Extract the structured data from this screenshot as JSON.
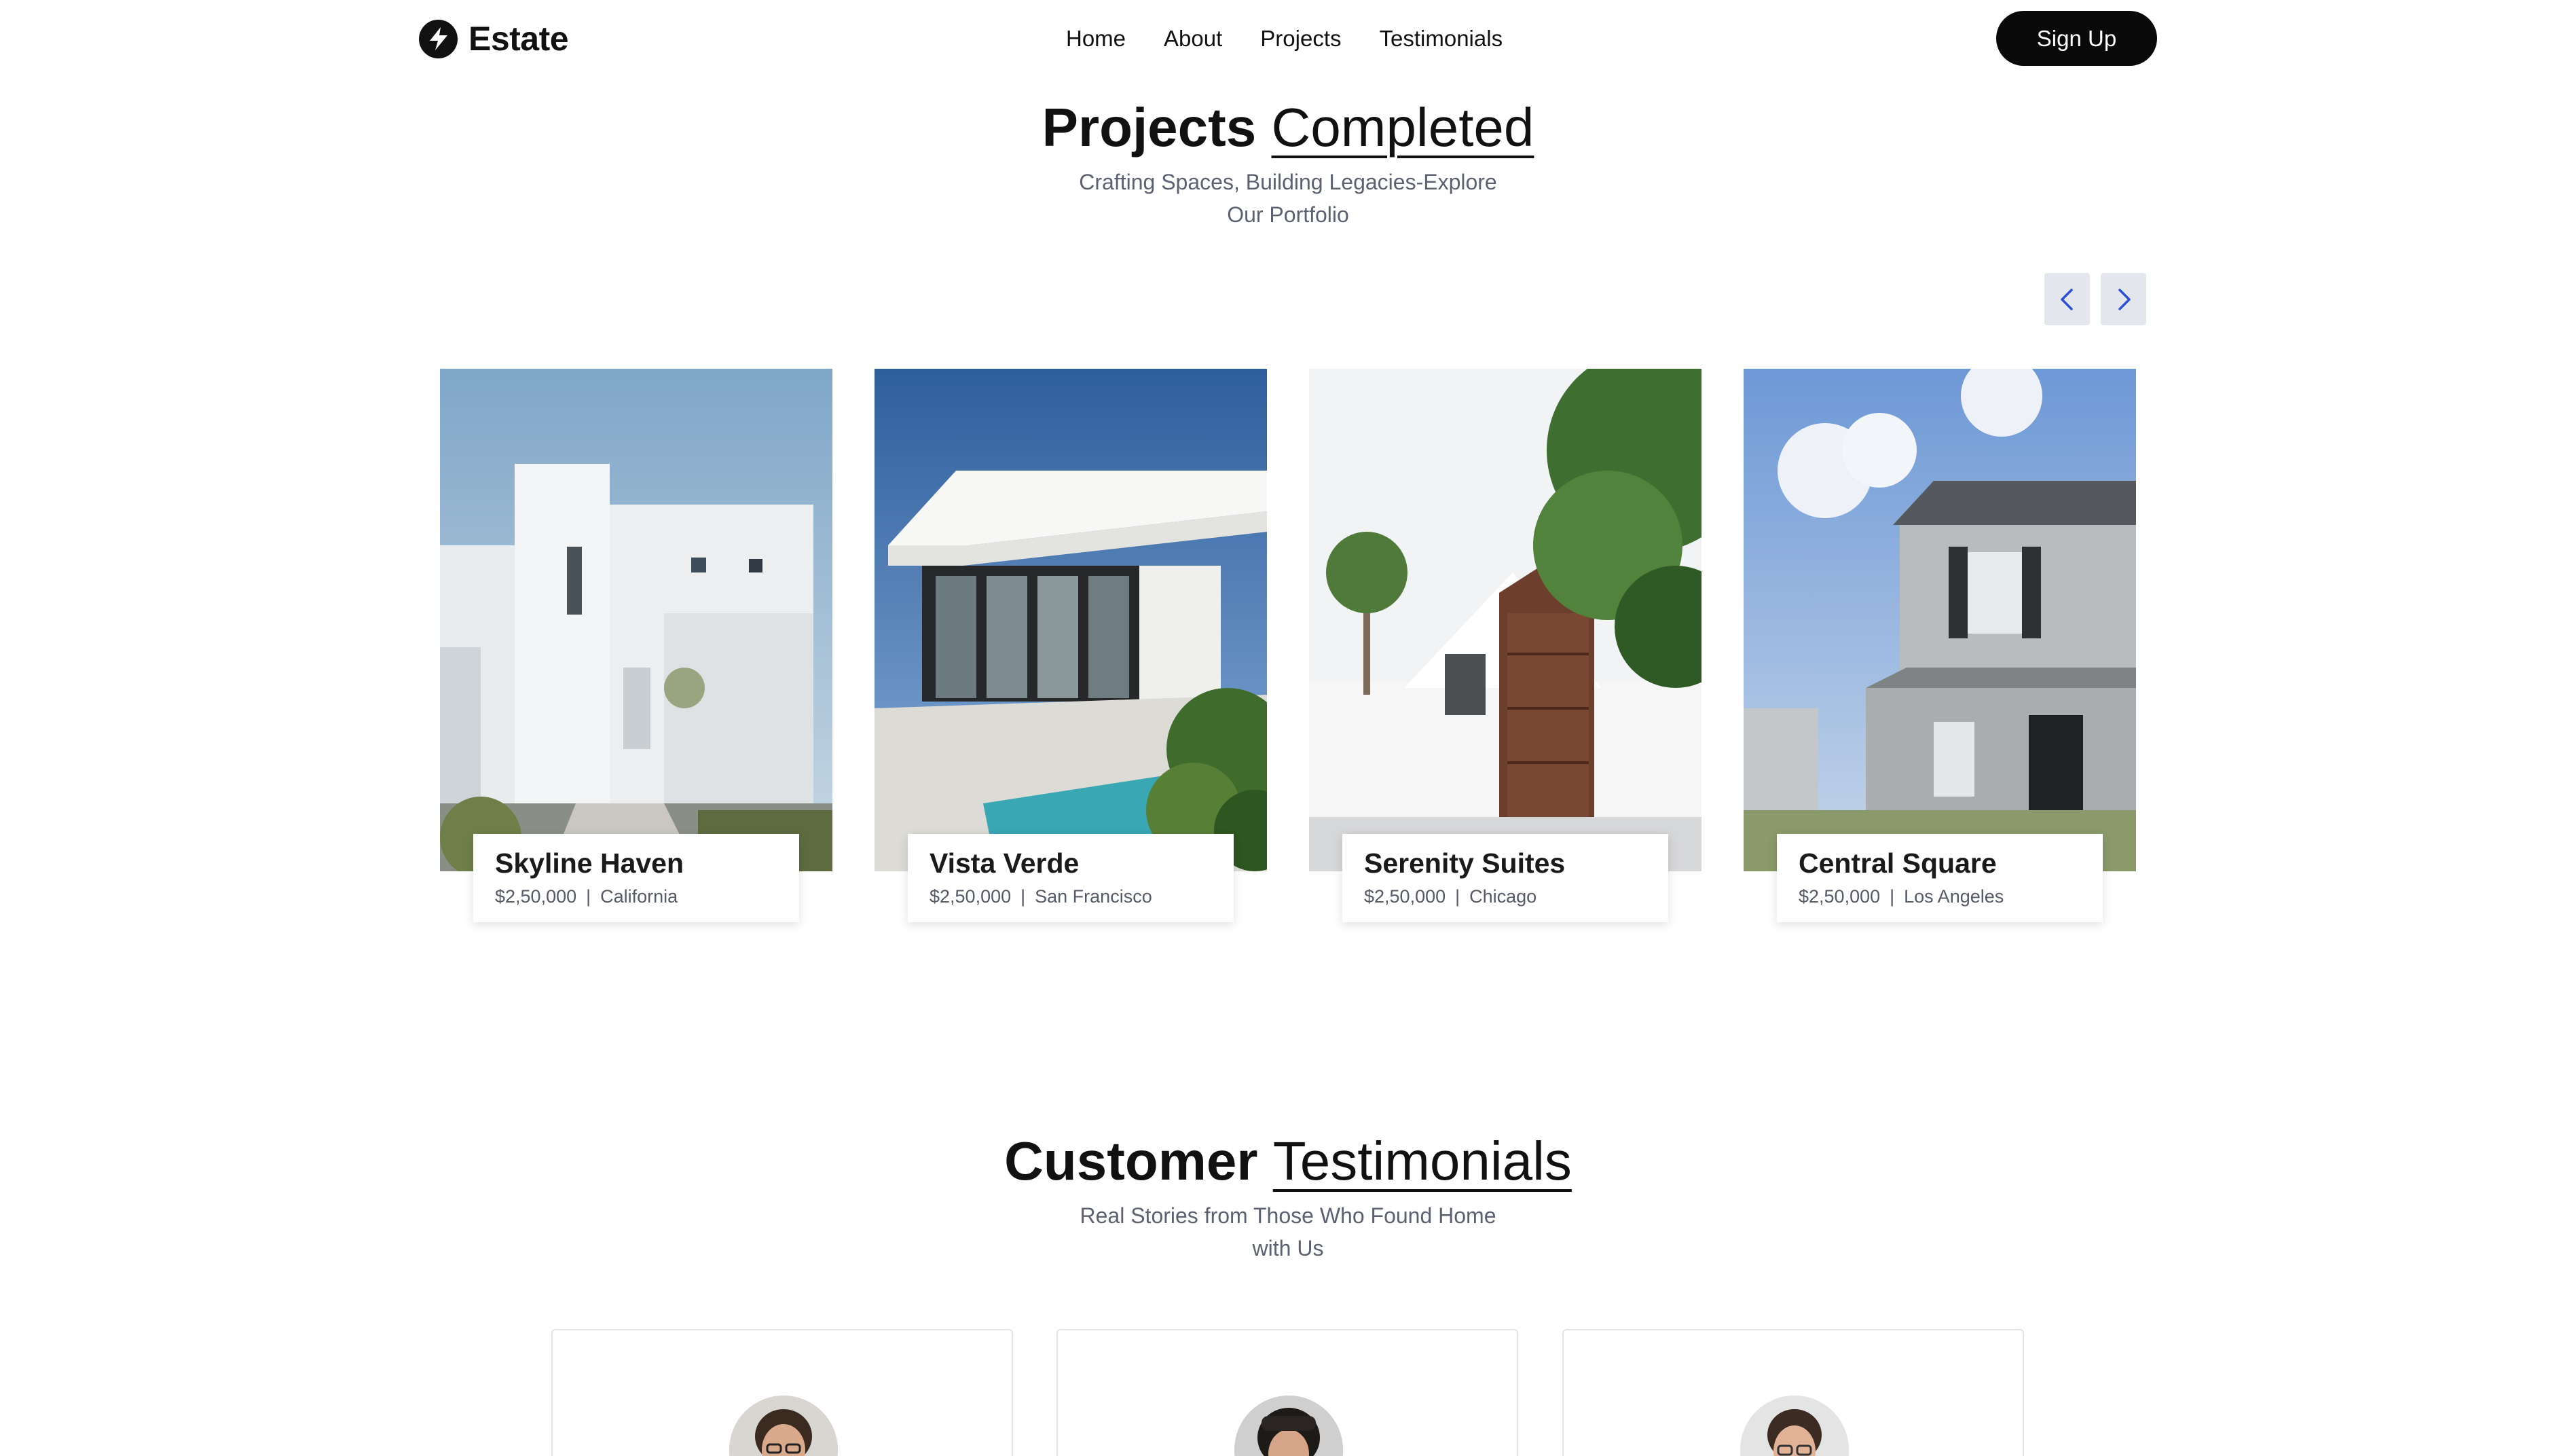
{
  "header": {
    "brand_name": "Estate",
    "nav_items": [
      "Home",
      "About",
      "Projects",
      "Testimonials"
    ],
    "signup_label": "Sign Up"
  },
  "projects": {
    "title_strong": "Projects",
    "title_light": "Completed",
    "subtitle_line1": "Crafting Spaces, Building Legacies-Explore",
    "subtitle_line2": "Our Portfolio",
    "items": [
      {
        "name": "Skyline Haven",
        "price": "$2,50,000",
        "location": "California"
      },
      {
        "name": "Vista Verde",
        "price": "$2,50,000",
        "location": "San Francisco"
      },
      {
        "name": "Serenity Suites",
        "price": "$2,50,000",
        "location": "Chicago"
      },
      {
        "name": "Central Square",
        "price": "$2,50,000",
        "location": "Los Angeles"
      }
    ],
    "separator": "|"
  },
  "testimonials": {
    "title_strong": "Customer",
    "title_light": "Testimonials",
    "subtitle_line1": "Real Stories from Those Who Found Home",
    "subtitle_line2": "with Us"
  },
  "icons": {
    "brand": "lightning-bolt-icon",
    "prev": "chevron-left-icon",
    "next": "chevron-right-icon"
  },
  "colors": {
    "accent": "#2b4fd6",
    "dark": "#0a0a0a",
    "muted_text": "#5c6170",
    "arrow_bg": "#e3e6ec"
  }
}
